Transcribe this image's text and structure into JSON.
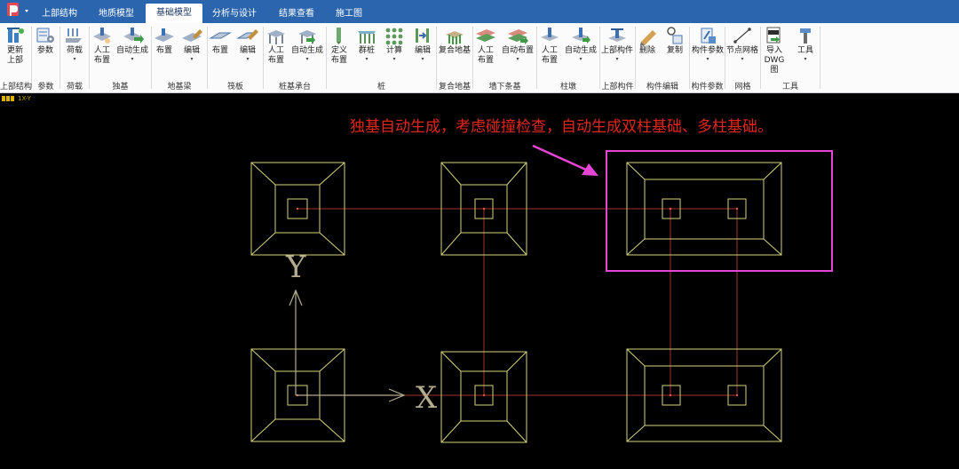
{
  "tabs": [
    {
      "label": "上部结构"
    },
    {
      "label": "地质模型"
    },
    {
      "label": "基础模型"
    },
    {
      "label": "分析与设计"
    },
    {
      "label": "结果查看"
    },
    {
      "label": "施工图"
    }
  ],
  "ribbon": {
    "buttons": [
      {
        "label": "更新\n上部",
        "icon": "update-structure-icon"
      },
      {
        "label": "参数",
        "icon": "settings-icon"
      },
      {
        "label": "荷载",
        "icon": "load-icon",
        "dropdown": true
      },
      {
        "label": "人工\n布置",
        "icon": "manual-place-icon"
      },
      {
        "label": "自动生成",
        "icon": "auto-generate-icon",
        "dropdown": true
      },
      {
        "label": "布置",
        "icon": "beam-place-icon"
      },
      {
        "label": "编辑",
        "icon": "beam-edit-icon",
        "dropdown": true
      },
      {
        "label": "布置",
        "icon": "slab-place-icon"
      },
      {
        "label": "编辑",
        "icon": "slab-edit-icon",
        "dropdown": true
      },
      {
        "label": "人工\n布置",
        "icon": "pile-cap-manual-icon"
      },
      {
        "label": "自动生成",
        "icon": "pile-cap-auto-icon",
        "dropdown": true
      },
      {
        "label": "定义\n布置",
        "icon": "pile-define-icon"
      },
      {
        "label": "群桩",
        "icon": "pile-group-icon",
        "dropdown": true
      },
      {
        "label": "计算",
        "icon": "calculate-icon",
        "dropdown": true
      },
      {
        "label": "编辑",
        "icon": "pile-edit-icon",
        "dropdown": true
      },
      {
        "label": "复合地基",
        "icon": "composite-ground-icon"
      },
      {
        "label": "人工\n布置",
        "icon": "strip-manual-icon"
      },
      {
        "label": "自动布置",
        "icon": "strip-auto-icon",
        "dropdown": true
      },
      {
        "label": "人工\n布置",
        "icon": "pier-manual-icon"
      },
      {
        "label": "自动生成",
        "icon": "pier-auto-icon",
        "dropdown": true
      },
      {
        "label": "上部构件",
        "icon": "upper-member-icon",
        "dropdown": true
      },
      {
        "label": "删除",
        "icon": "delete-icon"
      },
      {
        "label": "复制",
        "icon": "copy-icon"
      },
      {
        "label": "构件参数",
        "icon": "member-params-icon",
        "dropdown": true
      },
      {
        "label": "节点网格",
        "icon": "node-grid-icon",
        "dropdown": true
      },
      {
        "label": "导入\nDWG图",
        "icon": "import-dwg-icon"
      },
      {
        "label": "工具",
        "icon": "tools-icon",
        "dropdown": true
      }
    ],
    "groups": [
      {
        "label": "上部结构"
      },
      {
        "label": "参数"
      },
      {
        "label": "荷载"
      },
      {
        "label": "独基"
      },
      {
        "label": "地基梁"
      },
      {
        "label": "筏板"
      },
      {
        "label": "桩基承台"
      },
      {
        "label": "桩"
      },
      {
        "label": "复合地基"
      },
      {
        "label": "墙下条基"
      },
      {
        "label": "柱墩"
      },
      {
        "label": "上部构件"
      },
      {
        "label": "构件编辑"
      },
      {
        "label": "构件参数"
      },
      {
        "label": "网格"
      },
      {
        "label": "工具"
      }
    ],
    "dropdown_caret": "▾"
  },
  "view": {
    "label": "1X-Y"
  },
  "canvas": {
    "annotation": "独基自动生成，考虑碰撞检查，自动生成双柱基础、多柱基础。",
    "axis_x_label": "X",
    "axis_y_label": "Y",
    "colors": {
      "background": "#000000",
      "footing": "#d6d37e",
      "grid_line": "#a0332d",
      "axis": "#b2ab8e",
      "highlight": "#e545d4",
      "annotation": "#e1251b"
    }
  }
}
